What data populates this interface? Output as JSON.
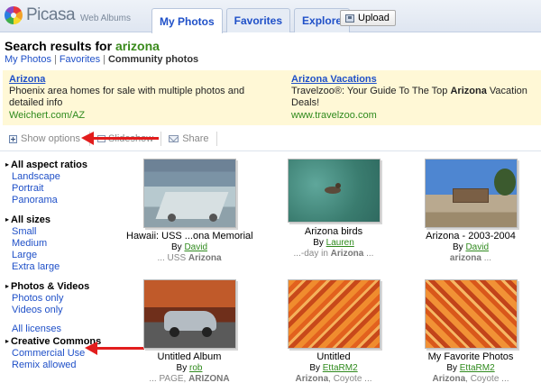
{
  "header": {
    "logo_text": "Picasa",
    "logo_sub": "Web Albums",
    "tabs": [
      {
        "label": "My Photos"
      },
      {
        "label": "Favorites"
      },
      {
        "label": "Explore"
      }
    ],
    "upload_label": "Upload"
  },
  "search": {
    "prefix": "Search results for ",
    "term": "arizona"
  },
  "breadcrumb": {
    "items": [
      "My Photos",
      "Favorites",
      "Community photos"
    ],
    "separator": "|"
  },
  "ads": [
    {
      "title": "Arizona",
      "desc": "Phoenix area homes for sale with multiple photos and detailed info",
      "url": "Weichert.com/AZ"
    },
    {
      "title": "Arizona Vacations",
      "desc_pre": "Travelzoo®: Your Guide To The Top ",
      "desc_bold": "Arizona",
      "desc_post": " Vacation Deals!",
      "url": "www.travelzoo.com"
    }
  ],
  "toolbar": {
    "show_options": "Show options",
    "slideshow": "Slideshow",
    "share": "Share"
  },
  "filters": {
    "aspect": {
      "head": "All aspect ratios",
      "options": [
        "Landscape",
        "Portrait",
        "Panorama"
      ]
    },
    "sizes": {
      "head": "All sizes",
      "options": [
        "Small",
        "Medium",
        "Large",
        "Extra large"
      ]
    },
    "media": {
      "head": "Photos & Videos",
      "options": [
        "Photos only",
        "Videos only"
      ]
    },
    "licenses": {
      "all": "All licenses",
      "head": "Creative Commons",
      "options": [
        "Commercial Use",
        "Remix allowed"
      ]
    }
  },
  "albums": [
    {
      "title": "Hawaii: USS ...ona Memorial",
      "by": "By ",
      "user": "David",
      "desc_pre": "... USS ",
      "desc_bold": "Arizona",
      "desc_post": ""
    },
    {
      "title": "Arizona birds",
      "by": "By ",
      "user": "Lauren",
      "desc_pre": "...-day in ",
      "desc_bold": "Arizona",
      "desc_post": " ..."
    },
    {
      "title": "Arizona - 2003-2004",
      "by": "By ",
      "user": "David",
      "desc_pre": "",
      "desc_bold": "arizona",
      "desc_post": " ..."
    },
    {
      "title": "Untitled Album",
      "by": "By ",
      "user": "rob",
      "desc_pre": "... PAGE, ",
      "desc_bold": "ARIZONA",
      "desc_post": ""
    },
    {
      "title": "Untitled",
      "by": "By ",
      "user": "EttaRM2",
      "desc_pre": "",
      "desc_bold": "Arizona",
      "desc_post": ", Coyote ..."
    },
    {
      "title": "My Favorite Photos",
      "by": "By ",
      "user": "EttaRM2",
      "desc_pre": "",
      "desc_bold": "Arizona",
      "desc_post": ", Coyote ..."
    }
  ],
  "colors": {
    "link": "#1f50c8",
    "green": "#3a8a1c",
    "ad_bg": "#fff8d6",
    "arrow": "#e21d1d"
  }
}
